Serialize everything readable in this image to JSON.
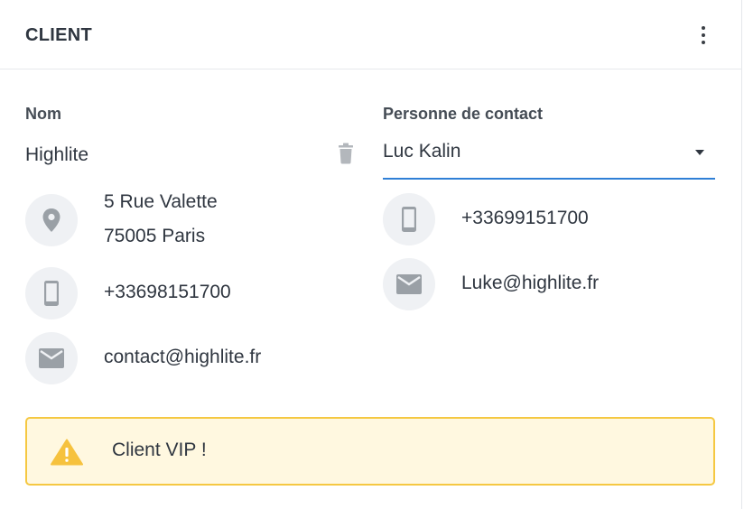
{
  "header": {
    "title": "CLIENT",
    "menu_icon": "kebab-menu-icon"
  },
  "client": {
    "name_label": "Nom",
    "name": "Highlite",
    "address_line1": "5 Rue Valette",
    "address_line2": "75005 Paris",
    "phone": "+33698151700",
    "email": "contact@highlite.fr"
  },
  "contact": {
    "label": "Personne de contact",
    "selected": "Luc Kalin",
    "phone": "+33699151700",
    "email": "Luke@highlite.fr"
  },
  "alert": {
    "text": "Client VIP !",
    "color": "#f5c842",
    "background": "#fff8e0"
  },
  "colors": {
    "accent": "#2f7fd6",
    "icon": "#9aa0a6",
    "icon_bg": "#eff1f4",
    "warning": "#f6c23e"
  }
}
